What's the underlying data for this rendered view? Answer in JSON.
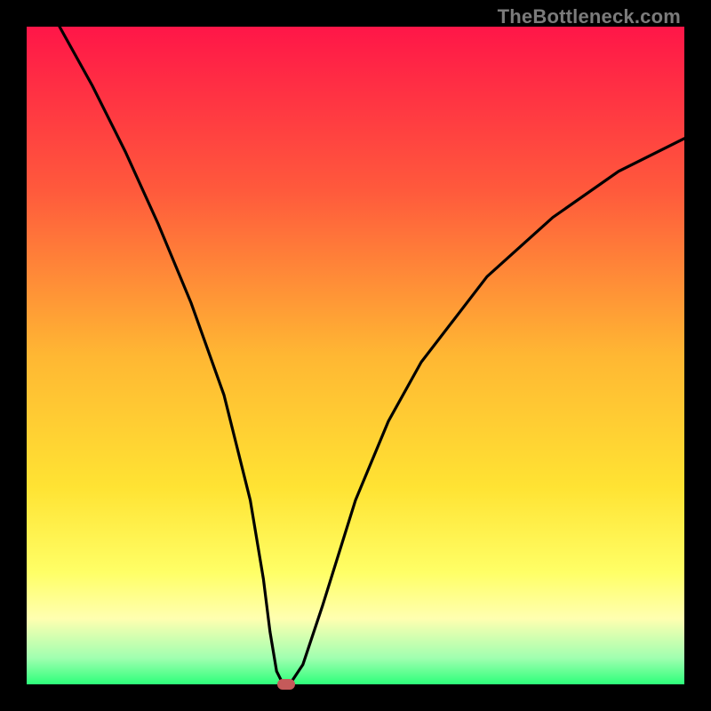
{
  "watermark": "TheBottleneck.com",
  "chart_data": {
    "type": "line",
    "title": "",
    "xlabel": "",
    "ylabel": "",
    "xlim": [
      0,
      100
    ],
    "ylim": [
      0,
      100
    ],
    "grid": false,
    "series": [
      {
        "name": "curve",
        "color": "#000000",
        "x": [
          5,
          10,
          15,
          20,
          25,
          30,
          34,
          36,
          37,
          38,
          39,
          40,
          42,
          45,
          50,
          55,
          60,
          70,
          80,
          90,
          100
        ],
        "y": [
          100,
          91,
          81,
          70,
          58,
          44,
          28,
          16,
          8,
          2,
          0,
          0,
          3,
          12,
          28,
          40,
          49,
          62,
          71,
          78,
          83
        ]
      }
    ],
    "marker": {
      "x": 39.5,
      "y": 0,
      "color": "#c55a5a"
    },
    "background_gradient": {
      "top": "#ff1648",
      "bottom": "#2dff7a"
    }
  }
}
